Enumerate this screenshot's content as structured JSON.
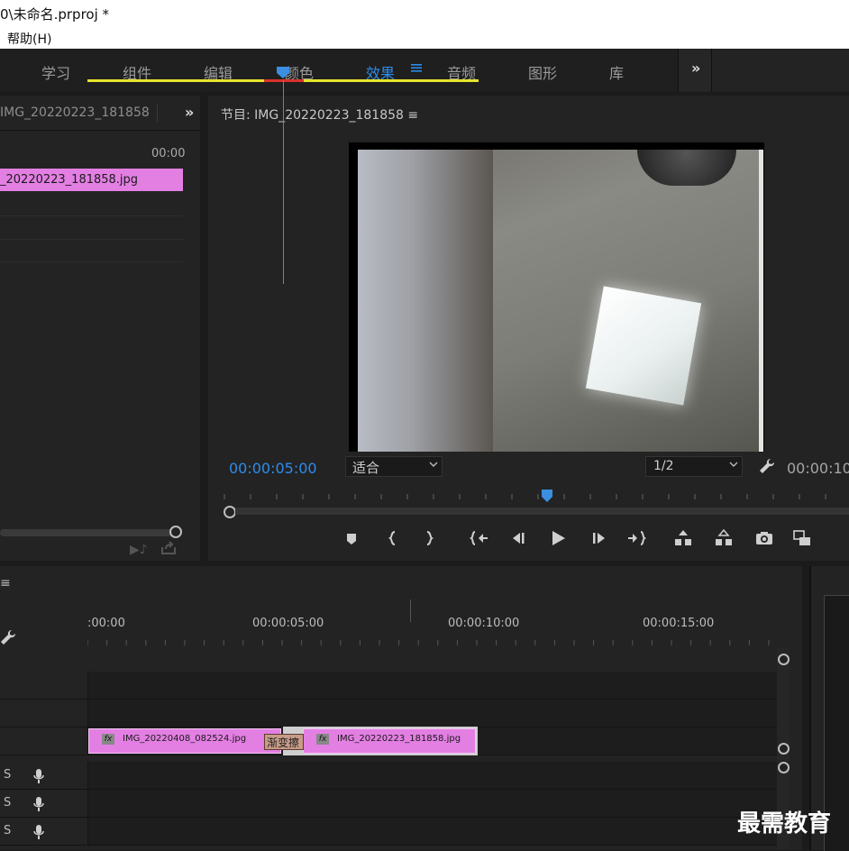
{
  "window": {
    "title": "0\\未命名.prproj *"
  },
  "menu": {
    "help": "帮助(H)"
  },
  "workspace": {
    "tabs": [
      {
        "label": "学习"
      },
      {
        "label": "组件"
      },
      {
        "label": "编辑"
      },
      {
        "label": "颜色"
      },
      {
        "label": "效果",
        "active": true
      },
      {
        "label": "音频"
      },
      {
        "label": "图形"
      },
      {
        "label": "库"
      }
    ],
    "more": "»"
  },
  "source": {
    "title": "IMG_20220223_181858",
    "more": "»",
    "timecode": "00:00",
    "clip_name": "_20220223_181858.jpg"
  },
  "program": {
    "title": "节目: IMG_20220223_181858 ≡",
    "timecode": "00:00:05:00",
    "fit": "适合",
    "resolution": "1/2",
    "duration": "00:00:10",
    "playhead_fraction": 0.5
  },
  "timeline": {
    "menu": "≡",
    "timecodes": [
      ":00:00",
      "00:00:05:00",
      "00:00:10:00",
      "00:00:15:00"
    ],
    "clips": [
      {
        "name": "IMG_20220408_082524.jpg"
      },
      {
        "name": "IMG_20220223_181858.jpg"
      }
    ],
    "transition": "渐变擦",
    "audio_tracks": [
      {
        "s": "S"
      },
      {
        "s": "S"
      },
      {
        "s": "S"
      }
    ]
  },
  "watermark": "最需教育",
  "colors": {
    "accent": "#2d8ceb",
    "clip": "#e37fe3",
    "work_area": "#e5e52b",
    "render_red": "#d9322b"
  }
}
